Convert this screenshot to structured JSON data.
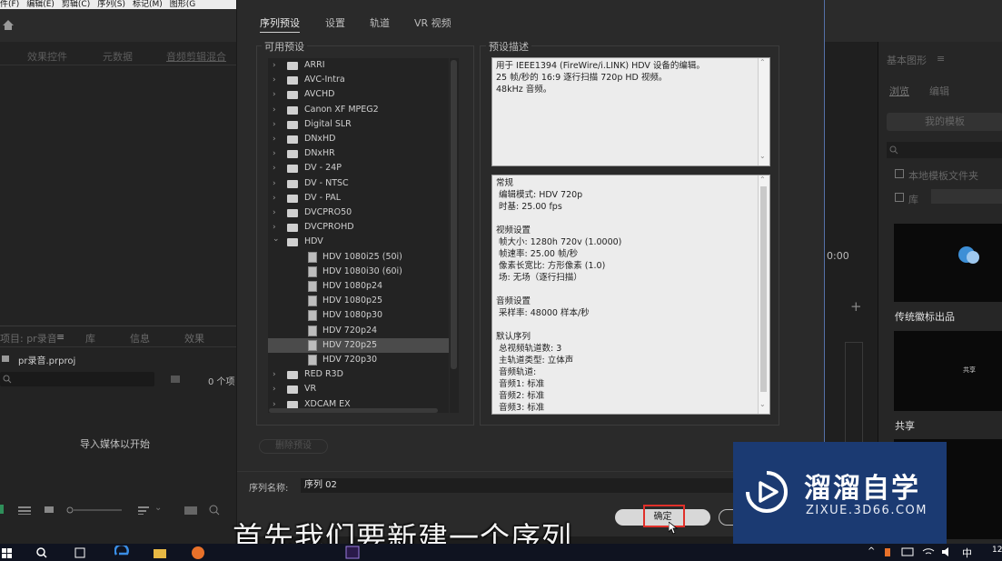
{
  "menubar": {
    "items": [
      "件(F)",
      "编辑(E)",
      "剪辑(C)",
      "序列(S)",
      "标记(M)",
      "图形(G"
    ]
  },
  "left_panel": {
    "tabs": [
      "效果控件",
      "元数据",
      "音频剪辑混合"
    ]
  },
  "project_panel": {
    "tabs": [
      "项目: pr录音",
      "库",
      "信息",
      "效果"
    ],
    "file_name": "pr录音.prproj",
    "item_count": "0 个项",
    "empty_hint": "导入媒体以开始"
  },
  "timeline": {
    "timecode": "0:00"
  },
  "right_panel": {
    "title": "基本图形",
    "tabs": [
      "浏览",
      "编辑"
    ],
    "my_templates": "我的模板",
    "local_templates": "本地模板文件夹",
    "library": "库",
    "template1": "传统徽标出品",
    "template2_thumb": "共享",
    "template2": "共享"
  },
  "dialog": {
    "tabs": [
      "序列预设",
      "设置",
      "轨道",
      "VR 视频"
    ],
    "available_presets_label": "可用预设",
    "preset_description_label": "预设描述",
    "presets": [
      {
        "label": "ARRI",
        "type": "folder",
        "expanded": false
      },
      {
        "label": "AVC-Intra",
        "type": "folder",
        "expanded": false
      },
      {
        "label": "AVCHD",
        "type": "folder",
        "expanded": false
      },
      {
        "label": "Canon XF MPEG2",
        "type": "folder",
        "expanded": false
      },
      {
        "label": "Digital SLR",
        "type": "folder",
        "expanded": false
      },
      {
        "label": "DNxHD",
        "type": "folder",
        "expanded": false
      },
      {
        "label": "DNxHR",
        "type": "folder",
        "expanded": false
      },
      {
        "label": "DV - 24P",
        "type": "folder",
        "expanded": false
      },
      {
        "label": "DV - NTSC",
        "type": "folder",
        "expanded": false
      },
      {
        "label": "DV - PAL",
        "type": "folder",
        "expanded": false
      },
      {
        "label": "DVCPRO50",
        "type": "folder",
        "expanded": false
      },
      {
        "label": "DVCPROHD",
        "type": "folder",
        "expanded": false
      },
      {
        "label": "HDV",
        "type": "folder",
        "expanded": true
      },
      {
        "label": "HDV 1080i25 (50i)",
        "type": "file"
      },
      {
        "label": "HDV 1080i30 (60i)",
        "type": "file"
      },
      {
        "label": "HDV 1080p24",
        "type": "file"
      },
      {
        "label": "HDV 1080p25",
        "type": "file"
      },
      {
        "label": "HDV 1080p30",
        "type": "file"
      },
      {
        "label": "HDV 720p24",
        "type": "file"
      },
      {
        "label": "HDV 720p25",
        "type": "file",
        "selected": true
      },
      {
        "label": "HDV 720p30",
        "type": "file"
      },
      {
        "label": "RED R3D",
        "type": "folder",
        "expanded": false
      },
      {
        "label": "VR",
        "type": "folder",
        "expanded": false
      },
      {
        "label": "XDCAM EX",
        "type": "folder",
        "expanded": false
      }
    ],
    "description_top": "用于 IEEE1394 (FireWire/i.LINK) HDV 设备的编辑。\n25 帧/秒的 16:9 逐行扫描 720p HD 视频。\n48kHz 音频。",
    "description_details": "常规\n 编辑模式: HDV 720p\n 时基: 25.00 fps\n\n视频设置\n 帧大小: 1280h 720v (1.0000)\n 帧速率: 25.00 帧/秒\n 像素长宽比: 方形像素 (1.0)\n 场: 无场（逐行扫描）\n\n音频设置\n 采样率: 48000 样本/秒\n\n默认序列\n 总视频轨道数: 3\n 主轨道类型: 立体声\n 音频轨道:\n 音频1: 标准\n 音频2: 标准\n 音频3: 标准",
    "delete_preset": "删除预设",
    "sequence_name_label": "序列名称:",
    "sequence_name_value": "序列 02",
    "ok_button": "确定"
  },
  "watermark": {
    "title": "溜溜自学",
    "url": "ZIXUE.3D66.COM"
  },
  "subtitle": "首先我们要新建一个序列",
  "taskbar": {
    "ime": "中",
    "clock": "12"
  },
  "colors": {
    "dialog_bg": "#2a2a2a",
    "selection": "#4b4b4b",
    "watermark_bg": "#1b3a72",
    "dialog_border": "#5571a8",
    "ok_highlight": "#e0302a"
  }
}
